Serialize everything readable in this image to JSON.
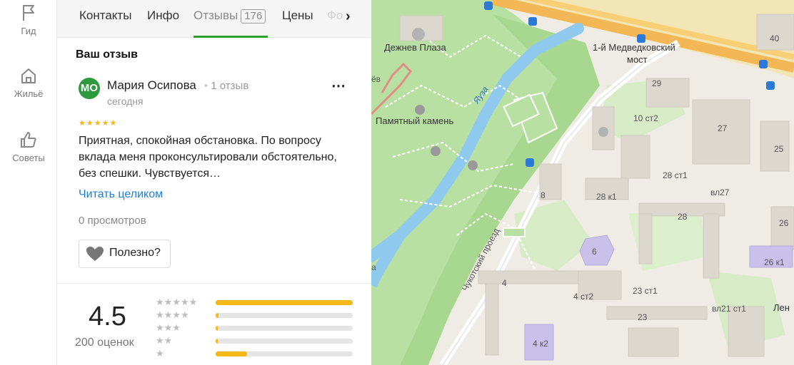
{
  "rail": {
    "items": [
      {
        "label": "Гид",
        "icon": "flag-icon"
      },
      {
        "label": "Жильё",
        "icon": "house-icon"
      },
      {
        "label": "Советы",
        "icon": "thumbs-up-icon"
      }
    ]
  },
  "tabs": {
    "items": [
      {
        "label": "Контакты"
      },
      {
        "label": "Инфо"
      },
      {
        "label": "Отзывы",
        "count": "176"
      },
      {
        "label": "Цены"
      },
      {
        "label": "Фо"
      }
    ],
    "active_color": "#2aa02a"
  },
  "review": {
    "section_title": "Ваш отзыв",
    "avatar_initials": "МО",
    "avatar_color": "#2d9a3e",
    "author": "Мария Осипова",
    "author_reviews": "1 отзыв",
    "date": "сегодня",
    "stars": 5,
    "text": "Приятная, спокойная обстановка. По вопросу вклада меня проконсультировали обстоятельно, без спешки. Чувствуется…",
    "read_more": "Читать целиком",
    "views": "0 просмотров",
    "helpful": "Полезно?"
  },
  "rating": {
    "value": "4.5",
    "count_label": "200 оценок",
    "distribution": [
      {
        "stars": 5,
        "fraction": 1.0
      },
      {
        "stars": 4,
        "fraction": 0.02
      },
      {
        "stars": 3,
        "fraction": 0.01
      },
      {
        "stars": 2,
        "fraction": 0.01
      },
      {
        "stars": 1,
        "fraction": 0.23
      }
    ],
    "bar_color": "#f6b818"
  },
  "map": {
    "labels": [
      {
        "text": "Дежнев Плаза"
      },
      {
        "text": "1-й Медведковский"
      },
      {
        "text": "мост"
      },
      {
        "text": "40"
      },
      {
        "text": "29"
      },
      {
        "text": "10 ст2"
      },
      {
        "text": "27"
      },
      {
        "text": "25"
      },
      {
        "text": "28 ст1"
      },
      {
        "text": "8"
      },
      {
        "text": "28 к1"
      },
      {
        "text": "вл27"
      },
      {
        "text": "28"
      },
      {
        "text": "26"
      },
      {
        "text": "6"
      },
      {
        "text": "26 к1"
      },
      {
        "text": "4"
      },
      {
        "text": "4 ст2"
      },
      {
        "text": "23 ст1"
      },
      {
        "text": "23"
      },
      {
        "text": "вл21 ст1"
      },
      {
        "text": "Лен"
      },
      {
        "text": "4 к2"
      },
      {
        "text": "Памятный камень"
      },
      {
        "text": "Яуза"
      },
      {
        "text": "Чукотский проезд"
      },
      {
        "text": "ёв"
      },
      {
        "text": "а"
      }
    ]
  }
}
